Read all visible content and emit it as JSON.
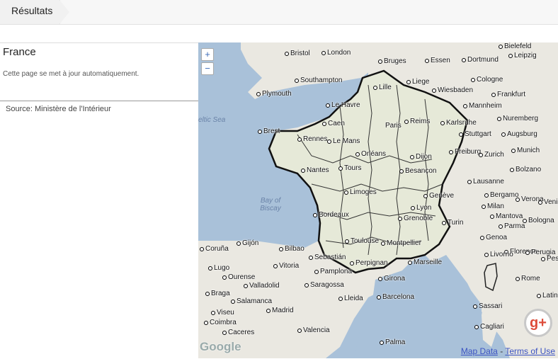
{
  "tab": {
    "label": "Résultats"
  },
  "panel": {
    "title": "France",
    "update_note": "Cette page se met à jour automatiquement.",
    "source": "Source: Ministère de l'Intérieur"
  },
  "map": {
    "zoom_in": "+",
    "zoom_out": "−",
    "google_logo": "Google",
    "map_data_link": "Map Data",
    "separator": "-",
    "terms_link": "Terms of Use",
    "seas": [
      "eltic Sea",
      "Bay of Biscay"
    ],
    "cities": [
      "Bristol",
      "London",
      "Bielefeld",
      "Essen",
      "Dortmund",
      "Leipzig",
      "Southampton",
      "Plymouth",
      "Bruges",
      "Lille",
      "Liege",
      "Cologne",
      "Wiesbaden",
      "Frankfurt",
      "Le Havre",
      "Caen",
      "Paris",
      "Reims",
      "Mannheim",
      "Nuremberg",
      "Brest",
      "Rennes",
      "Le Mans",
      "Orléans",
      "Dijon",
      "Karlsruhe",
      "Stuttgart",
      "Augsburg",
      "Nantes",
      "Tours",
      "Besançon",
      "Freiburg",
      "Zurich",
      "Munich",
      "Limoges",
      "Genève",
      "Lausanne",
      "Bolzano",
      "Bergamo",
      "Verona",
      "Venice",
      "Lyon",
      "Grenoble",
      "Milan",
      "Turin",
      "Bordeaux",
      "Genoa",
      "Bologna",
      "Toulouse",
      "Montpellier",
      "Marseille",
      "Florence",
      "Gijón",
      "Bilbao",
      "Sebastián",
      "Coruña",
      "Lugo",
      "Ourense",
      "Vitoria",
      "Pamplona",
      "Perpignan",
      "Valladolid",
      "Saragossa",
      "Girona",
      "Barcelona",
      "Braga",
      "Salamanca",
      "Lleida",
      "Viseu",
      "Madrid",
      "Coimbra",
      "Caceres",
      "Valencia",
      "Palma",
      "Rome",
      "Latina",
      "Cagliari",
      "Sassari",
      "Perugia",
      "Pescara",
      "Livorno",
      "Mantova",
      "Parma"
    ]
  }
}
